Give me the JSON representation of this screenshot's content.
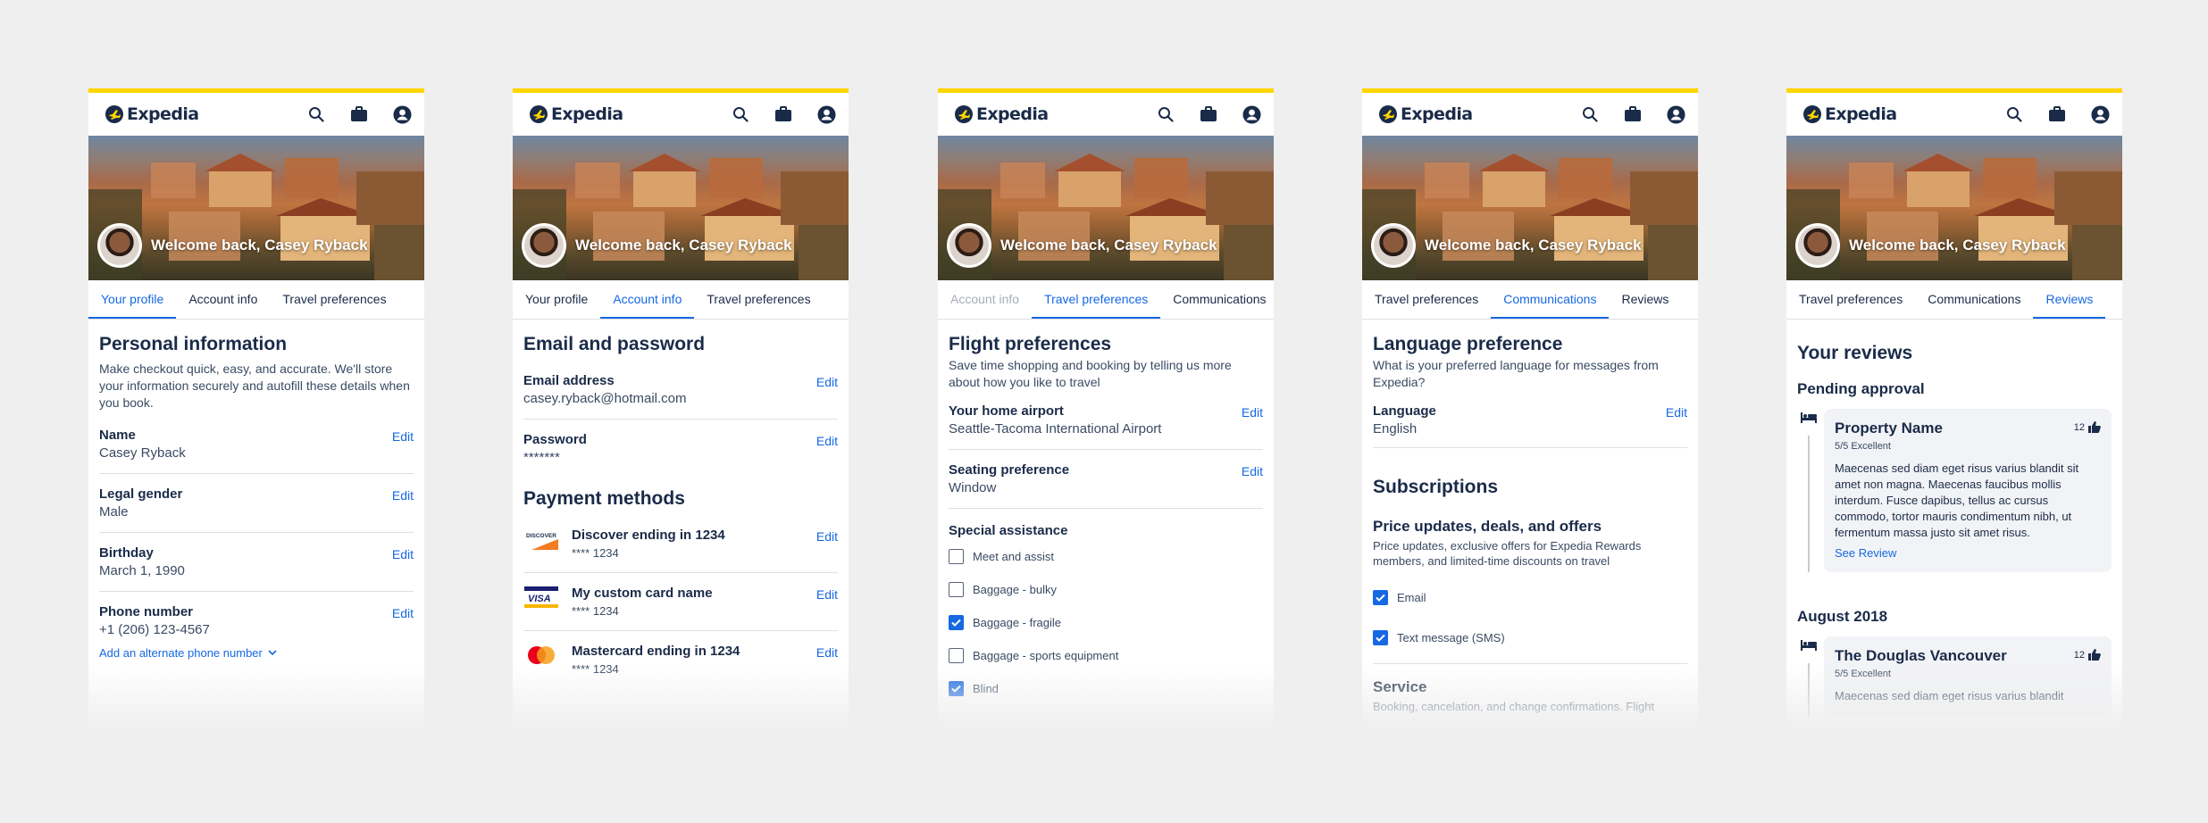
{
  "brand": {
    "name": "Expedia",
    "accent": "#1668e3",
    "topbar": "#ffd500",
    "navy": "#1a2b49"
  },
  "welcome": "Welcome back, Casey Ryback",
  "screens": [
    {
      "tabs": [
        "Your profile",
        "Account info",
        "Travel preferences"
      ],
      "title": "Personal information",
      "description": "Make checkout quick, easy, and accurate. We'll store your information securely and autofill these details when you book.",
      "fields": [
        {
          "label": "Name",
          "value": "Casey Ryback",
          "edit": "Edit"
        },
        {
          "label": "Legal gender",
          "value": "Male",
          "edit": "Edit"
        },
        {
          "label": "Birthday",
          "value": "March 1, 1990",
          "edit": "Edit"
        },
        {
          "label": "Phone number",
          "value": "+1 (206) 123-4567",
          "edit": "Edit"
        }
      ],
      "alt_phone_link": "Add an alternate phone number"
    },
    {
      "tabs": [
        "Your profile",
        "Account info",
        "Travel preferences"
      ],
      "title": "Email and password",
      "fields": [
        {
          "label": "Email address",
          "value": "casey.ryback@hotmail.com",
          "edit": "Edit"
        },
        {
          "label": "Password",
          "value": "*******",
          "edit": "Edit"
        }
      ],
      "payment_title": "Payment methods",
      "payments": [
        {
          "title": "Discover ending in 1234",
          "sub": "**** 1234",
          "edit": "Edit",
          "logo_text": "DISCOVER"
        },
        {
          "title": "My custom card name",
          "sub": "**** 1234",
          "edit": "Edit",
          "logo_text": "VISA"
        },
        {
          "title": "Mastercard ending in 1234",
          "sub": "**** 1234",
          "edit": "Edit"
        }
      ]
    },
    {
      "tabs": [
        "Account info",
        "Travel preferences",
        "Communications"
      ],
      "title": "Flight preferences",
      "description": "Save time shopping and booking by telling us more about how you like to travel",
      "fields": [
        {
          "label": "Your home airport",
          "value": "Seattle-Tacoma International Airport",
          "edit": "Edit"
        },
        {
          "label": "Seating preference",
          "value": "Window",
          "edit": "Edit"
        }
      ],
      "assist_title": "Special assistance",
      "options": [
        {
          "label": "Meet and assist",
          "checked": false
        },
        {
          "label": "Baggage - bulky",
          "checked": false
        },
        {
          "label": "Baggage - fragile",
          "checked": true
        },
        {
          "label": "Baggage - sports equipment",
          "checked": false
        },
        {
          "label": "Blind",
          "checked": true
        }
      ]
    },
    {
      "tabs": [
        "Travel preferences",
        "Communications",
        "Reviews"
      ],
      "title": "Language preference",
      "description": "What is your preferred language for messages from Expedia?",
      "fields": [
        {
          "label": "Language",
          "value": "English",
          "edit": "Edit"
        }
      ],
      "subs_title": "Subscriptions",
      "deals_title": "Price updates, deals, and offers",
      "deals_desc": "Price updates, exclusive offers for Expedia Rewards members, and limited-time discounts on travel",
      "deals_options": [
        {
          "label": "Email",
          "checked": true
        },
        {
          "label": "Text message (SMS)",
          "checked": true
        }
      ],
      "service_title": "Service",
      "service_desc": "Booking, cancelation, and change confirmations. Flight"
    },
    {
      "tabs": [
        "Travel preferences",
        "Communications",
        "Reviews"
      ],
      "title": "Your reviews",
      "pending_title": "Pending approval",
      "reviews": [
        {
          "property": "Property Name",
          "rating": "5/5 Excellent",
          "likes": "12",
          "body": "Maecenas sed diam eget risus varius blandit sit amet non magna. Maecenas faucibus mollis interdum. Fusce dapibus, tellus ac cursus commodo, tortor mauris condimentum nibh, ut fermentum massa justo sit amet risus.",
          "link": "See Review"
        }
      ],
      "section2_title": "August 2018",
      "reviews2": [
        {
          "property": "The Douglas Vancouver",
          "rating": "5/5 Excellent",
          "likes": "12",
          "body": "Maecenas sed diam eget risus varius blandit"
        }
      ]
    }
  ]
}
